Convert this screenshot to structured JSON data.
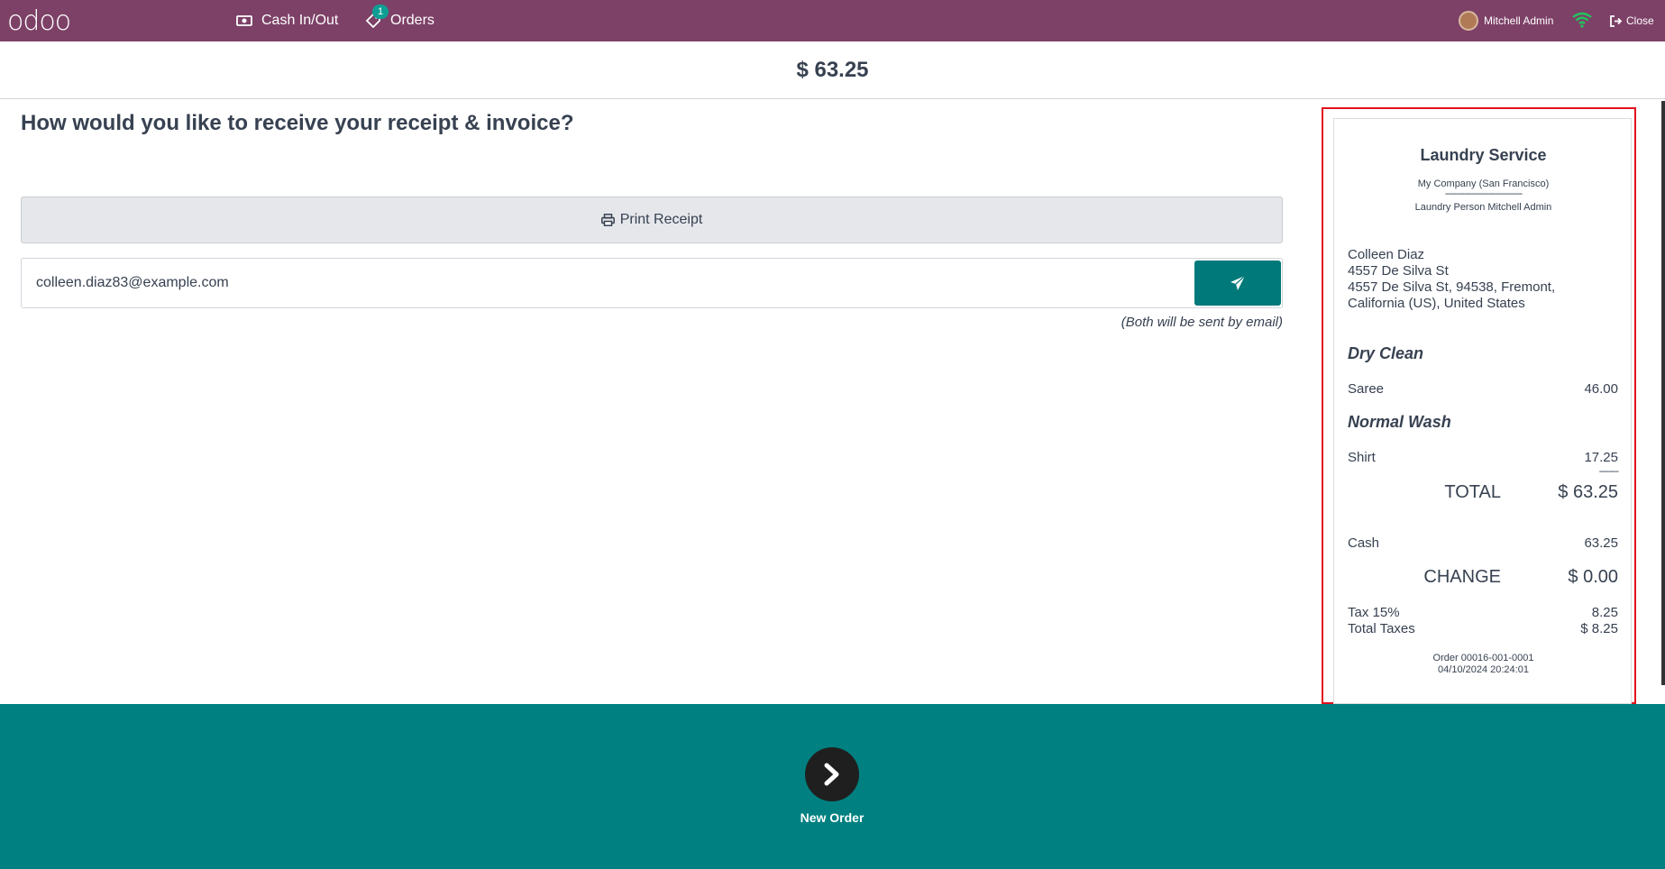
{
  "topbar": {
    "logo": "odoo",
    "cash_label": "Cash In/Out",
    "orders_label": "Orders",
    "orders_badge": "1",
    "user_name": "Mitchell Admin",
    "close_label": "Close"
  },
  "header": {
    "amount": "$ 63.25"
  },
  "main": {
    "question": "How would you like to receive your receipt & invoice?",
    "print_label": "Print Receipt",
    "email_value": "colleen.diaz83@example.com",
    "email_note": "(Both will be sent by email)"
  },
  "receipt": {
    "title": "Laundry Service",
    "company": "My Company (San Francisco)",
    "dash": "--------------------------------",
    "person": "Laundry Person Mitchell Admin",
    "customer_name": "Colleen Diaz",
    "address_line1": "4557 De Silva St",
    "address_line2": "4557 De Silva St, 94538, Fremont,",
    "address_line3": "California (US), United States",
    "category1": "Dry Clean",
    "item1_name": "Saree",
    "item1_price": "46.00",
    "category2": "Normal Wash",
    "item2_name": "Shirt",
    "item2_price": "17.25",
    "separator": "--------",
    "total_label": "TOTAL",
    "total_value": "$ 63.25",
    "payment_label": "Cash",
    "payment_value": "63.25",
    "change_label": "CHANGE",
    "change_value": "$ 0.00",
    "tax_label": "Tax 15%",
    "tax_value": "8.25",
    "total_taxes_label": "Total Taxes",
    "total_taxes_value": "$ 8.25",
    "order_ref": "Order 00016-001-0001",
    "order_date": "04/10/2024 20:24:01"
  },
  "footer": {
    "new_order_label": "New Order"
  },
  "colors": {
    "topbar": "#7d4167",
    "accent": "#008080",
    "highlight": "#e2111d"
  }
}
